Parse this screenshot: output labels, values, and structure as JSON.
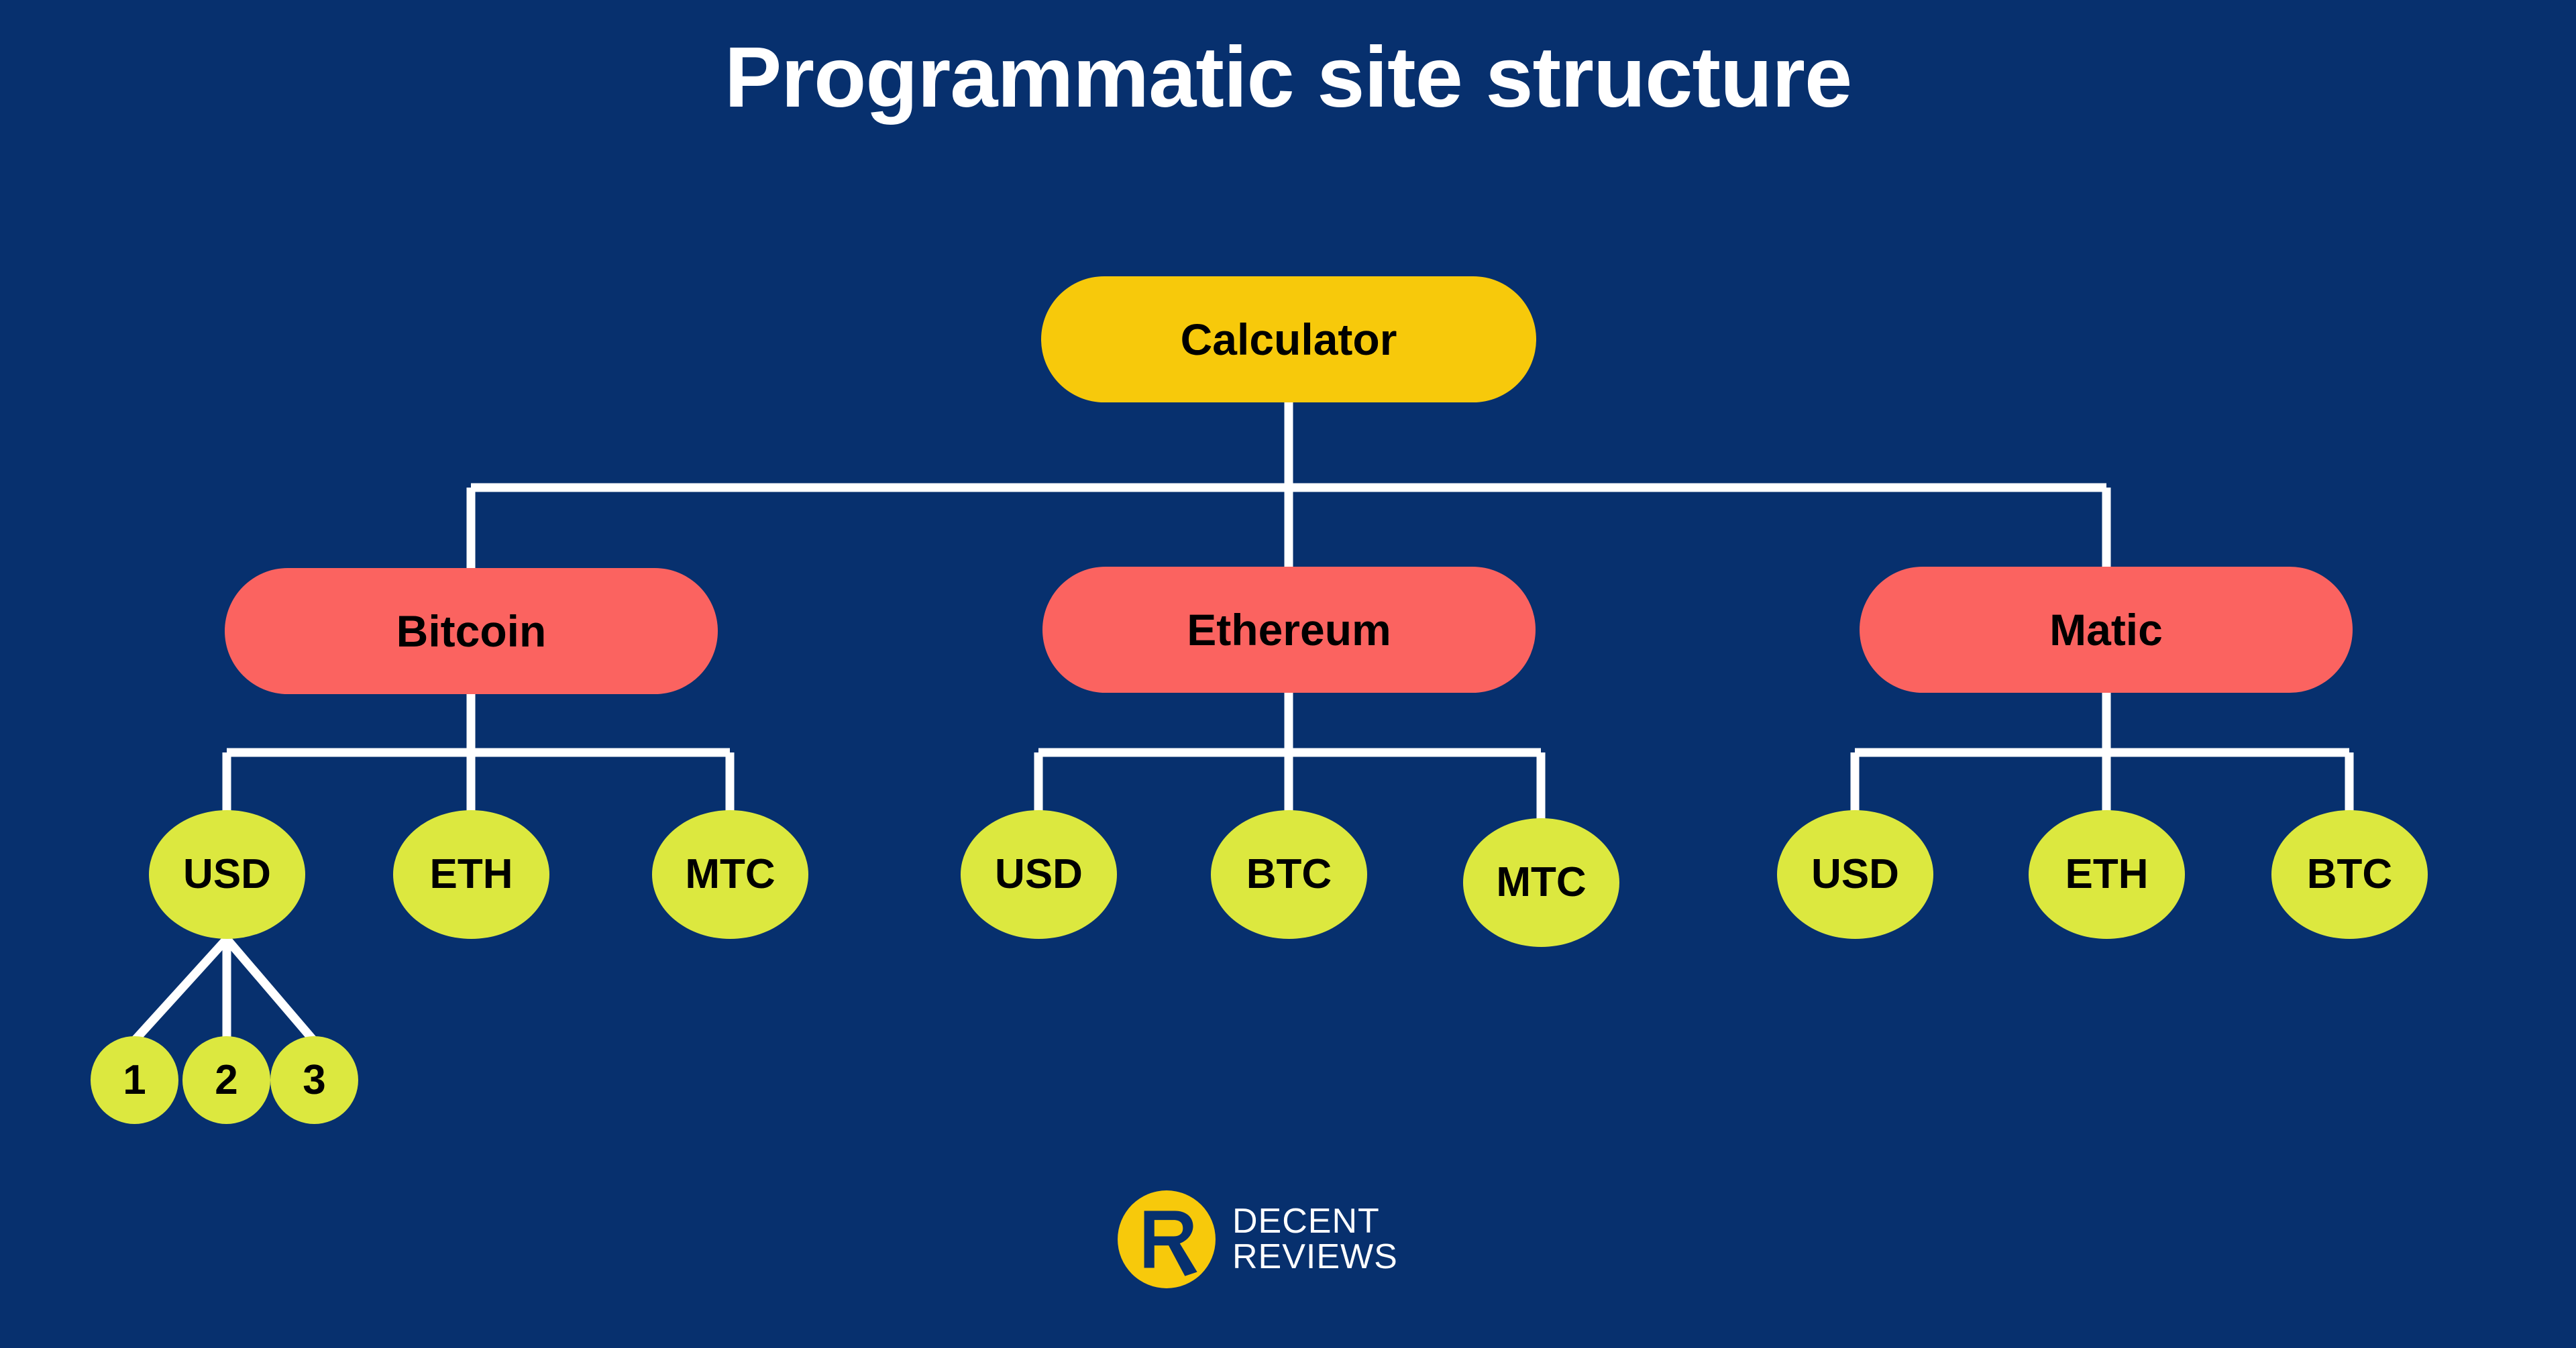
{
  "page": {
    "title": "Programmatic site structure",
    "background_color": "#07306E"
  },
  "colors": {
    "background": "#07306E",
    "root_node": "#F7C90B",
    "level2_node": "#FB6360",
    "level3_node": "#DCE83F",
    "leaf_node": "#DCE83F",
    "connector": "#FFFFFF",
    "node_text": "#000000",
    "title_text": "#FFFFFF",
    "logo_mark": "#F7C90B",
    "logo_text": "#FFFFFF"
  },
  "chart_data": {
    "type": "diagram",
    "subtype": "tree",
    "title": "Programmatic site structure",
    "orientation": "top-down",
    "connector_style": "orthogonal-elbow",
    "levels": 4,
    "root": {
      "id": "calculator",
      "label": "Calculator",
      "shape": "rounded-rectangle",
      "color": "#F7C90B",
      "children": [
        {
          "id": "bitcoin",
          "label": "Bitcoin",
          "shape": "rounded-rectangle",
          "color": "#FB6360",
          "children": [
            {
              "id": "bitcoin-usd",
              "label": "USD",
              "shape": "ellipse",
              "color": "#DCE83F",
              "children": [
                {
                  "id": "bitcoin-usd-1",
                  "label": "1",
                  "shape": "circle",
                  "color": "#DCE83F"
                },
                {
                  "id": "bitcoin-usd-2",
                  "label": "2",
                  "shape": "circle",
                  "color": "#DCE83F"
                },
                {
                  "id": "bitcoin-usd-3",
                  "label": "3",
                  "shape": "circle",
                  "color": "#DCE83F"
                }
              ]
            },
            {
              "id": "bitcoin-eth",
              "label": "ETH",
              "shape": "ellipse",
              "color": "#DCE83F"
            },
            {
              "id": "bitcoin-mtc",
              "label": "MTC",
              "shape": "ellipse",
              "color": "#DCE83F"
            }
          ]
        },
        {
          "id": "ethereum",
          "label": "Ethereum",
          "shape": "rounded-rectangle",
          "color": "#FB6360",
          "children": [
            {
              "id": "ethereum-usd",
              "label": "USD",
              "shape": "ellipse",
              "color": "#DCE83F"
            },
            {
              "id": "ethereum-btc",
              "label": "BTC",
              "shape": "ellipse",
              "color": "#DCE83F"
            },
            {
              "id": "ethereum-mtc",
              "label": "MTC",
              "shape": "ellipse",
              "color": "#DCE83F"
            }
          ]
        },
        {
          "id": "matic",
          "label": "Matic",
          "shape": "rounded-rectangle",
          "color": "#FB6360",
          "children": [
            {
              "id": "matic-usd",
              "label": "USD",
              "shape": "ellipse",
              "color": "#DCE83F"
            },
            {
              "id": "matic-eth",
              "label": "ETH",
              "shape": "ellipse",
              "color": "#DCE83F"
            },
            {
              "id": "matic-btc",
              "label": "BTC",
              "shape": "ellipse",
              "color": "#DCE83F"
            }
          ]
        }
      ]
    }
  },
  "nodes": {
    "root": {
      "label": "Calculator"
    },
    "level2": [
      {
        "label": "Bitcoin"
      },
      {
        "label": "Ethereum"
      },
      {
        "label": "Matic"
      }
    ],
    "bitcoin_children": [
      {
        "label": "USD"
      },
      {
        "label": "ETH"
      },
      {
        "label": "MTC"
      }
    ],
    "ethereum_children": [
      {
        "label": "USD"
      },
      {
        "label": "BTC"
      },
      {
        "label": "MTC"
      }
    ],
    "matic_children": [
      {
        "label": "USD"
      },
      {
        "label": "ETH"
      },
      {
        "label": "BTC"
      }
    ],
    "usd_leaves": [
      {
        "label": "1"
      },
      {
        "label": "2"
      },
      {
        "label": "3"
      }
    ]
  },
  "logo": {
    "monogram": "R",
    "line1": "DECENT",
    "line2": "REVIEWS"
  }
}
